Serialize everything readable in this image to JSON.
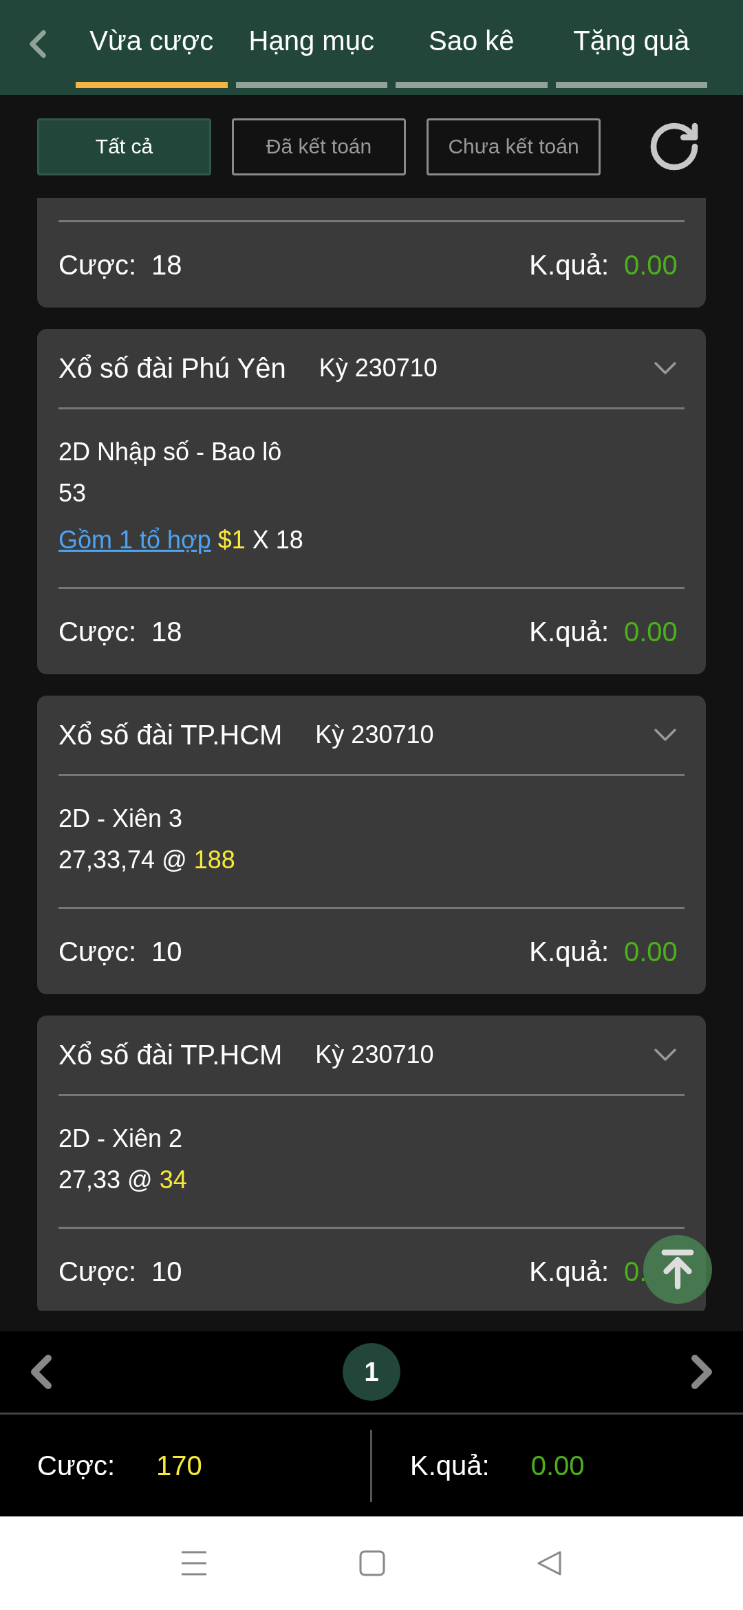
{
  "tabs": [
    {
      "label": "Vừa cược",
      "selected": true
    },
    {
      "label": "Hạng mục",
      "selected": false
    },
    {
      "label": "Sao kê",
      "selected": false
    },
    {
      "label": "Tặng quà",
      "selected": false
    }
  ],
  "filters": [
    {
      "label": "Tất cả",
      "selected": true
    },
    {
      "label": "Đã kết toán",
      "selected": false
    },
    {
      "label": "Chưa kết toán",
      "selected": false
    }
  ],
  "bets": [
    {
      "kind": "partial",
      "stake_label": "Cược:",
      "stake": "18",
      "result_label": "K.quả:",
      "result": "0.00"
    },
    {
      "kind": "full",
      "title": "Xổ số đài Phú Yên",
      "period": "Kỳ 230710",
      "details": [
        {
          "kind": "text",
          "text": "2D Nhập số - Bao lô"
        },
        {
          "kind": "text",
          "text": "53"
        },
        {
          "kind": "combo",
          "link": "Gồm 1 tổ hợp",
          "amount": "$1",
          "multiplier": "X 18"
        }
      ],
      "stake_label": "Cược:",
      "stake": "18",
      "result_label": "K.quả:",
      "result": "0.00"
    },
    {
      "kind": "full",
      "title": "Xổ số đài TP.HCM",
      "period": "Kỳ 230710",
      "details": [
        {
          "kind": "text",
          "text": "2D - Xiên 3"
        },
        {
          "kind": "odds",
          "numbers": "27,33,74 @",
          "odds": "188"
        }
      ],
      "stake_label": "Cược:",
      "stake": "10",
      "result_label": "K.quả:",
      "result": "0.00"
    },
    {
      "kind": "full",
      "title": "Xổ số đài TP.HCM",
      "period": "Kỳ 230710",
      "details": [
        {
          "kind": "text",
          "text": "2D - Xiên 2"
        },
        {
          "kind": "odds",
          "numbers": "27,33 @",
          "odds": "34"
        }
      ],
      "stake_label": "Cược:",
      "stake": "10",
      "result_label": "K.quả:",
      "result": "0."
    }
  ],
  "pager": {
    "page": "1"
  },
  "summary": {
    "stake_label": "Cược:",
    "stake": "170",
    "result_label": "K.quả:",
    "result": "0.00"
  }
}
